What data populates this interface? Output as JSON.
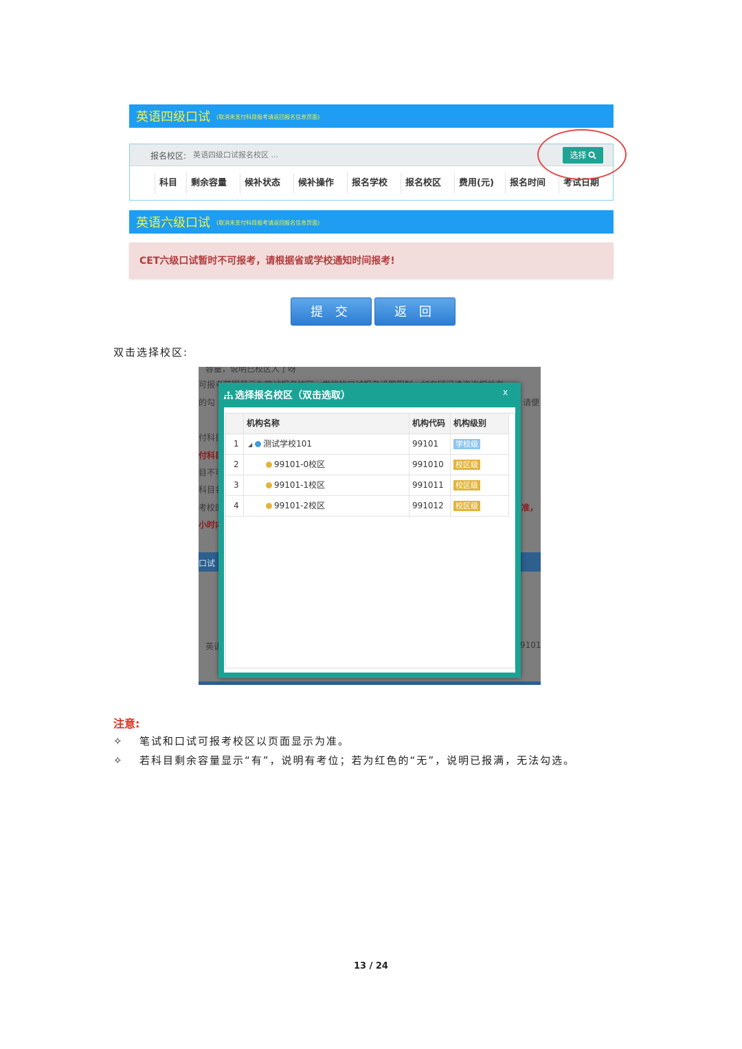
{
  "cet4_section": {
    "title": "英语四级口试",
    "note": "(取消未支付科目报考请返回报名信息页面)",
    "campus_label": "报名校区:",
    "campus_placeholder": "英语四级口试报名校区 ...",
    "select_button": "选择",
    "table_headers": [
      "科目",
      "剩余容量",
      "候补状态",
      "候补操作",
      "报名学校",
      "报名校区",
      "费用(元)",
      "报名时间",
      "考试日期"
    ]
  },
  "cet6_section": {
    "title": "英语六级口试",
    "note": "(取消未支付科目报考请返回报名信息页面)",
    "alert": "CET六级口试暂时不可报考，请根据省或学校通知时间报考!"
  },
  "buttons": {
    "submit": "提 交",
    "back": "返 回"
  },
  "caption": "双击选择校区:",
  "dialog": {
    "title": "选择报名校区（双击选取）",
    "close": "x",
    "columns": [
      "机构名称",
      "机构代码",
      "机构级别"
    ],
    "rows": [
      {
        "index": "1",
        "name": "测试学校101",
        "code": "99101",
        "level": "学校级"
      },
      {
        "index": "2",
        "name": "99101-0校区",
        "code": "991010",
        "level": "校区级"
      },
      {
        "index": "3",
        "name": "99101-1校区",
        "code": "991011",
        "level": "校区级"
      },
      {
        "index": "4",
        "name": "99101-2校区",
        "code": "991012",
        "level": "校区级"
      }
    ]
  },
  "background_fragments": {
    "top": "容量，说明已校区人了呀",
    "line1": "可报考范围显示为笔试报名校区，学校的口试报名设置限制，如有疑问请咨询相关老",
    "line2": "的勾",
    "line2_right": "请便",
    "left_column": [
      "付科目",
      "付科目",
      "目不可",
      "科目名",
      "考校的",
      "小时内"
    ],
    "right_red": "准，",
    "band": "口试",
    "bottom_left": "英语",
    "bottom_right": "9101"
  },
  "notice": {
    "title": "注意:",
    "items": [
      "笔试和口试可报考校区以页面显示为准。",
      "若科目剩余容量显示“有”，说明有考位；若为红色的“无”，说明已报满，无法勾选。"
    ],
    "bullet_symbol": "✧"
  },
  "page_number": "13 / 24",
  "colors": {
    "section_bar": "#1e9df2",
    "title_text": "#f7f23a",
    "dialog_header": "#1aa395",
    "level_school": "#8ec6ee",
    "level_campus": "#e2b43c",
    "notice_red": "#e0301e"
  }
}
